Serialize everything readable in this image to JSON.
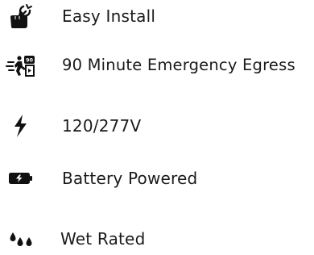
{
  "features": [
    {
      "icon": "hand-wrench-icon",
      "label": "Easy Install"
    },
    {
      "icon": "emergency-exit-icon",
      "label": "90 Minute Emergency Egress"
    },
    {
      "icon": "lightning-bolt-icon",
      "label": "120/277V"
    },
    {
      "icon": "battery-charging-icon",
      "label": "Battery Powered"
    },
    {
      "icon": "water-drops-icon",
      "label": "Wet Rated"
    }
  ],
  "colors": {
    "icon": "#111111",
    "text": "#1a1a1a",
    "background": "#ffffff"
  }
}
